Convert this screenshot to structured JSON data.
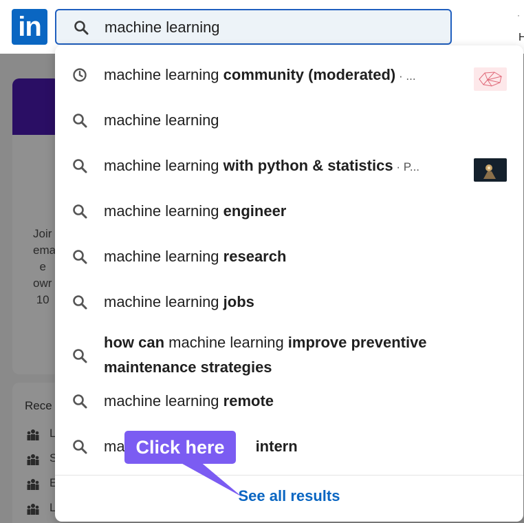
{
  "header": {
    "logo_text": "in",
    "search": {
      "value": "machine learning",
      "icon": "search-icon"
    },
    "right_glyph_top": "·",
    "right_glyph_bottom": "H"
  },
  "background": {
    "card_text": "Joir\nema\n  e\nowr\n 10",
    "recent_label": "Rece",
    "groups": [
      {
        "label": "L",
        "icon": "group-icon"
      },
      {
        "label": "S",
        "icon": "group-icon"
      },
      {
        "label": "E",
        "icon": "group-icon"
      },
      {
        "label": "L",
        "icon": "group-icon"
      }
    ]
  },
  "dropdown": {
    "suggestions": [
      {
        "icon": "clock-icon",
        "prefix": "machine learning ",
        "bold": "community (moderated)",
        "suffix": " · ...",
        "has_thumb": true,
        "thumb": "brain-thumbnail"
      },
      {
        "icon": "search-icon",
        "prefix": "machine learning",
        "bold": "",
        "suffix": "",
        "has_thumb": false
      },
      {
        "icon": "search-icon",
        "prefix": "machine learning ",
        "bold": "with python & statistics",
        "suffix": " · P...",
        "has_thumb": true,
        "thumb": "robot-hand-thumbnail"
      },
      {
        "icon": "search-icon",
        "prefix": "machine learning ",
        "bold": "engineer",
        "suffix": "",
        "has_thumb": false
      },
      {
        "icon": "search-icon",
        "prefix": "machine learning ",
        "bold": "research",
        "suffix": "",
        "has_thumb": false
      },
      {
        "icon": "search-icon",
        "prefix": "machine learning ",
        "bold": "jobs",
        "suffix": "",
        "has_thumb": false
      },
      {
        "icon": "search-icon",
        "bold_lead": "how can",
        "prefix": " machine learning ",
        "bold": "improve preventive maintenance strategies",
        "suffix": "",
        "has_thumb": false
      },
      {
        "icon": "search-icon",
        "prefix": "machine learning ",
        "bold": "remote",
        "suffix": "",
        "has_thumb": false
      },
      {
        "icon": "search-icon",
        "prefix": "ma",
        "bold": "intern",
        "suffix": "",
        "has_thumb": false
      }
    ],
    "see_all_label": "See all results"
  },
  "callout": {
    "label": "Click here",
    "color": "#7b5cf2"
  },
  "colors": {
    "brand": "#0a66c2",
    "search_bg": "#edf3f8",
    "search_border": "#1f5fbf",
    "overlay": "#8a8a8a"
  }
}
